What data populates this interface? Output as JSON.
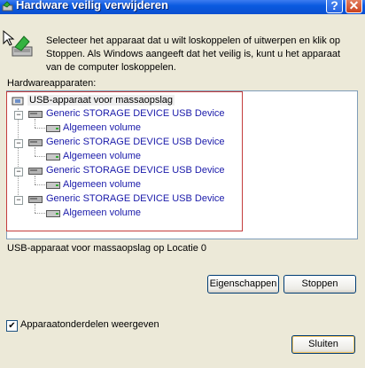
{
  "window": {
    "title": "Hardware veilig verwijderen",
    "help_label": "?",
    "close_label": "✕"
  },
  "instructions": "Selecteer het apparaat dat u wilt loskoppelen of uitwerpen en klik op Stoppen. Als Windows aangeeft dat het veilig is, kunt u het apparaat van de computer loskoppelen.",
  "devices_label": "Hardwareapparaten:",
  "tree": {
    "root": "USB-apparaat voor massaopslag",
    "devices": [
      {
        "label": "Generic STORAGE DEVICE USB Device",
        "volume": "Algemeen volume"
      },
      {
        "label": "Generic STORAGE DEVICE USB Device",
        "volume": "Algemeen volume"
      },
      {
        "label": "Generic STORAGE DEVICE USB Device",
        "volume": "Algemeen volume"
      },
      {
        "label": "Generic STORAGE DEVICE USB Device",
        "volume": "Algemeen volume"
      }
    ]
  },
  "status_text": "USB-apparaat voor massaopslag op Locatie 0",
  "buttons": {
    "properties": "Eigenschappen",
    "stop": "Stoppen",
    "close": "Sluiten"
  },
  "show_components": {
    "label": "Apparaatonderdelen weergeven",
    "checked": true,
    "check_mark": "✔"
  },
  "expander_symbol": "−",
  "colors": {
    "title_bar": "#0b4fd0",
    "window_bg": "#ece9d8",
    "link_text": "#1a1aaa",
    "selection_outline": "#c43c3c"
  }
}
